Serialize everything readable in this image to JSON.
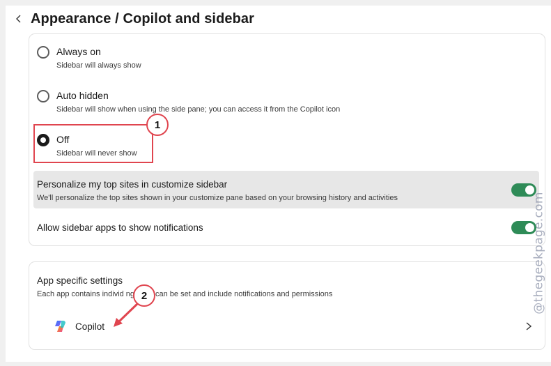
{
  "header": {
    "title": "Appearance / Copilot and sidebar"
  },
  "sidebar_options": [
    {
      "label": "Always on",
      "description": "Sidebar will always show",
      "selected": false
    },
    {
      "label": "Auto hidden",
      "description": "Sidebar will show when using the side pane; you can access it from the Copilot icon",
      "selected": false
    },
    {
      "label": "Off",
      "description": "Sidebar will never show",
      "selected": true
    }
  ],
  "settings": [
    {
      "label": "Personalize my top sites in customize sidebar",
      "description": "We'll personalize the top sites shown in your customize pane based on your browsing history and activities",
      "enabled": true
    },
    {
      "label": "Allow sidebar apps to show notifications",
      "enabled": true
    }
  ],
  "app_settings": {
    "title": "App specific settings",
    "description": "Each app contains individ      ngs that can be set and include notifications and permissions",
    "apps": [
      {
        "label": "Copilot",
        "icon": "copilot-logo-icon"
      }
    ]
  },
  "annotations": {
    "callout_1": "1",
    "callout_2": "2",
    "color": "#e0454f"
  },
  "watermark": "@thegeekpage.com",
  "colors": {
    "toggle_on": "#2e8b57",
    "highlight": "#e0454f"
  }
}
